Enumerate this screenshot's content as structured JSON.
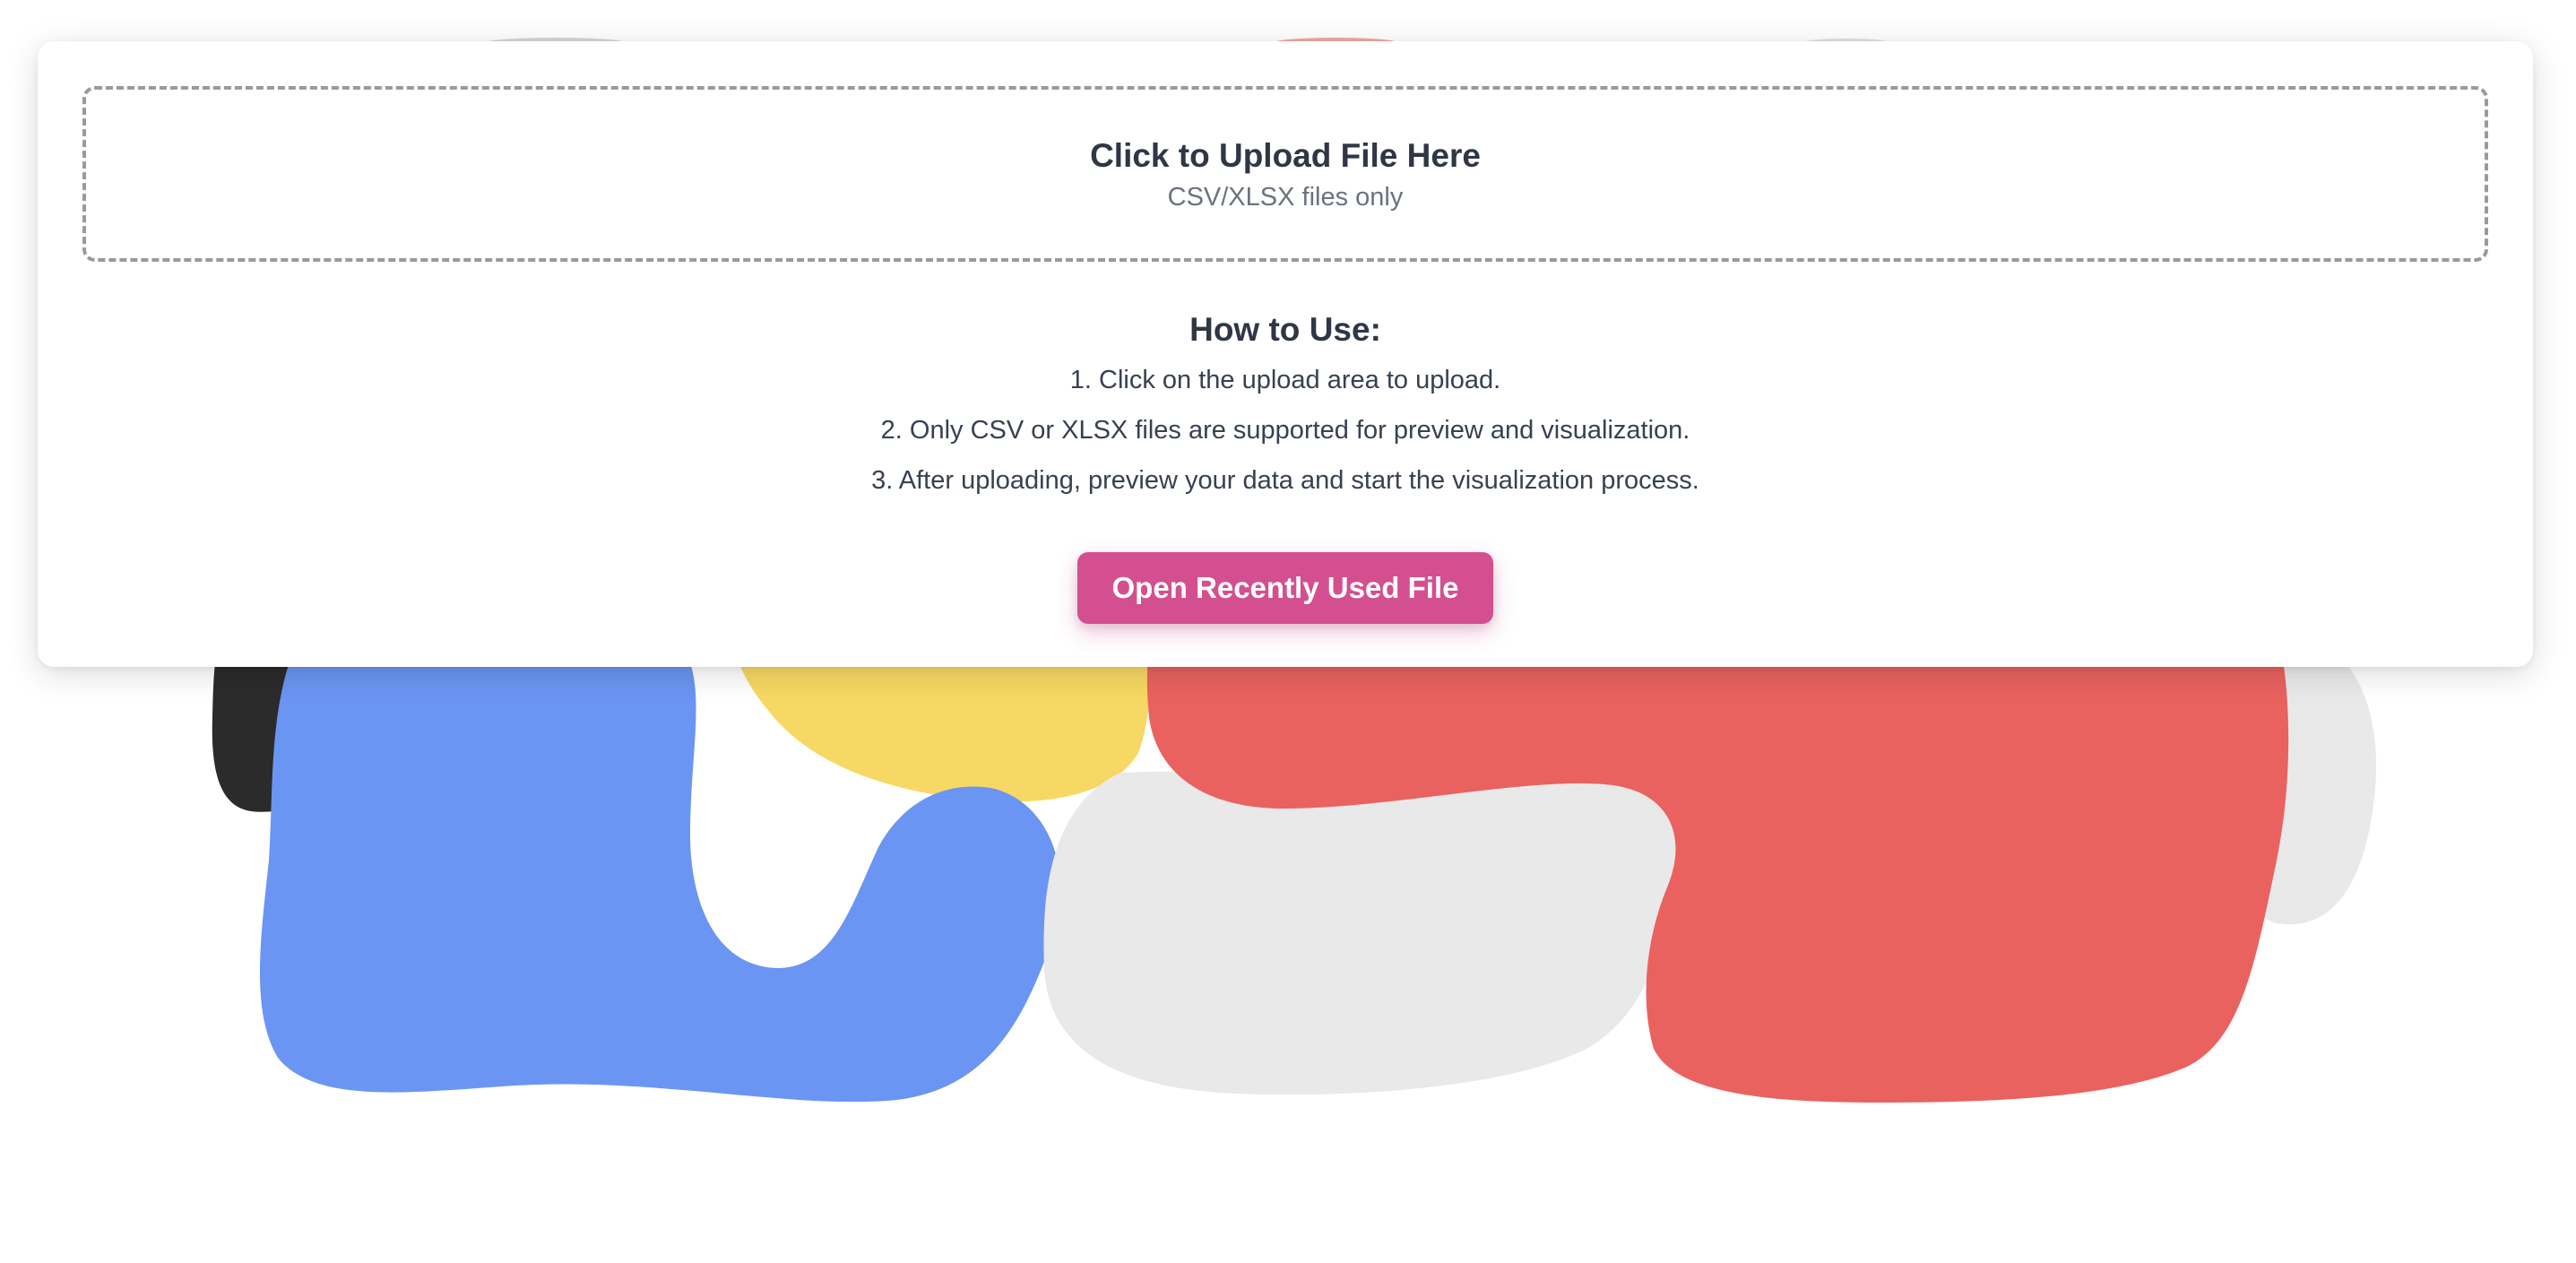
{
  "upload": {
    "title": "Click to Upload File Here",
    "subtitle": "CSV/XLSX files only"
  },
  "howto": {
    "title": "How to Use:",
    "steps": [
      "1. Click on the upload area to upload.",
      "2. Only CSV or XLSX files are supported for preview and visualization.",
      "3. After uploading, preview your data and start the visualization process."
    ]
  },
  "actions": {
    "recent_label": "Open Recently Used File"
  },
  "colors": {
    "accent_pink": "#d44f90",
    "blob_blue": "#6b95f2",
    "blob_yellow": "#f7d864",
    "blob_red": "#e96260",
    "blob_gray": "#e9e9e9",
    "blob_black": "#2b2b2b",
    "text_dark": "#2f3645",
    "text_muted": "#6b7280"
  }
}
